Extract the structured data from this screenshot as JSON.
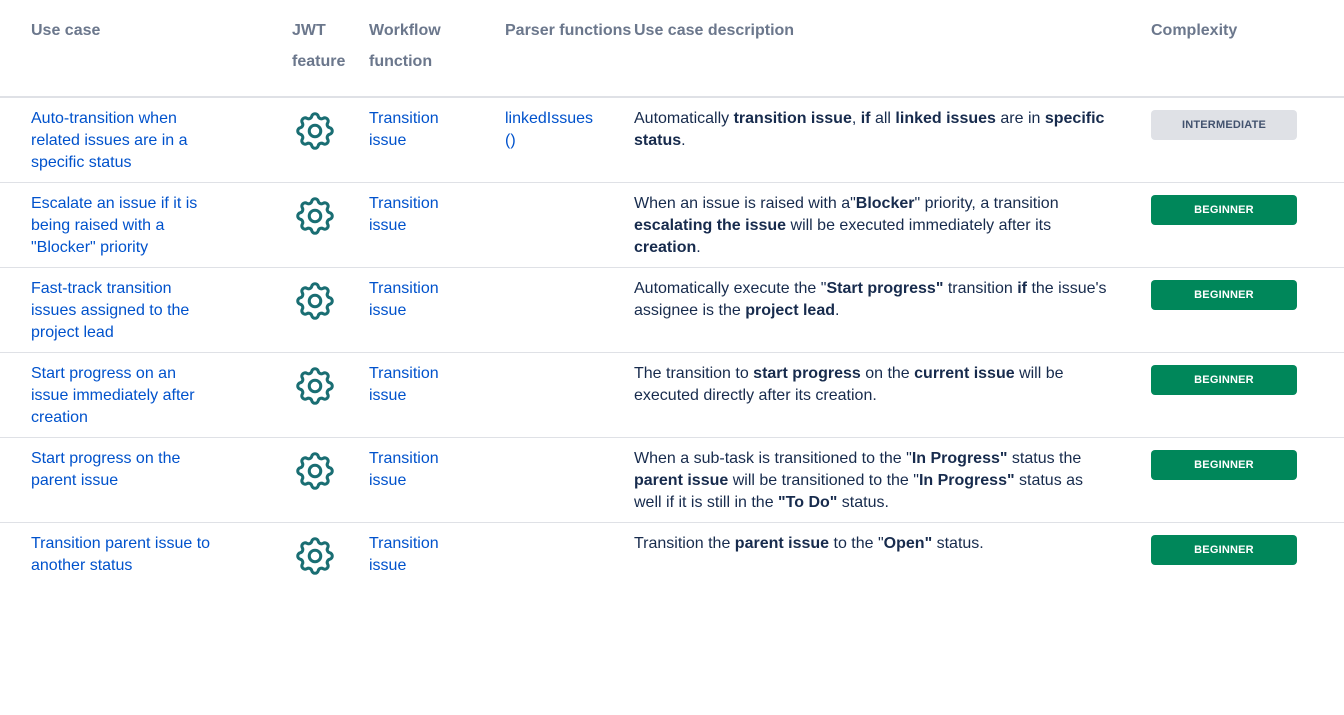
{
  "headers": {
    "use_case": "Use case",
    "jwt_feature": "JWT feature",
    "workflow_function": "Workflow function",
    "parser_functions": "Parser functions",
    "description": "Use case description",
    "complexity": "Complexity"
  },
  "icons": {
    "feature": "gear-icon",
    "color": "#1a6e73"
  },
  "colors": {
    "link": "#0052cc",
    "beginner": "#00875a",
    "intermediate": "#dfe1e6"
  },
  "rows": [
    {
      "use_case": "Auto-transition when related issues are in a specific status",
      "workflow_function": "Transition issue",
      "parser_functions": "linkedIssues()",
      "description": [
        {
          "t": "Automatically "
        },
        {
          "t": "transition issue",
          "b": true
        },
        {
          "t": ", "
        },
        {
          "t": "if",
          "b": true
        },
        {
          "t": " all "
        },
        {
          "t": "linked issues",
          "b": true
        },
        {
          "t": " are in "
        },
        {
          "t": "specific status",
          "b": true
        },
        {
          "t": "."
        }
      ],
      "complexity": "INTERMEDIATE",
      "complexity_level": "intermediate"
    },
    {
      "use_case": "Escalate an issue if it is being raised with a \"Blocker\" priority",
      "workflow_function": "Transition issue",
      "parser_functions": "",
      "description": [
        {
          "t": "When an issue is raised with a\""
        },
        {
          "t": "Blocker",
          "b": true
        },
        {
          "t": "\" priority, a transition "
        },
        {
          "t": "escalating the issue",
          "b": true
        },
        {
          "t": " will be executed immediately after its "
        },
        {
          "t": "creation",
          "b": true
        },
        {
          "t": "."
        }
      ],
      "complexity": "BEGINNER",
      "complexity_level": "beginner"
    },
    {
      "use_case": "Fast-track transition issues assigned to the project lead",
      "workflow_function": "Transition issue",
      "parser_functions": "",
      "description": [
        {
          "t": "Automatically execute the \""
        },
        {
          "t": "Start progress\"",
          "b": true
        },
        {
          "t": " transition "
        },
        {
          "t": "if",
          "b": true
        },
        {
          "t": " the issue's assignee is the "
        },
        {
          "t": "project lead",
          "b": true
        },
        {
          "t": "."
        }
      ],
      "complexity": "BEGINNER",
      "complexity_level": "beginner"
    },
    {
      "use_case": "Start progress on an issue immediately after creation",
      "workflow_function": "Transition issue",
      "parser_functions": "",
      "description": [
        {
          "t": "The transition to "
        },
        {
          "t": "start progress",
          "b": true
        },
        {
          "t": " on the "
        },
        {
          "t": "current issue",
          "b": true
        },
        {
          "t": " will be executed directly after its creation."
        }
      ],
      "complexity": "BEGINNER",
      "complexity_level": "beginner"
    },
    {
      "use_case": "Start progress on the parent issue",
      "workflow_function": "Transition issue",
      "parser_functions": "",
      "description": [
        {
          "t": "When a sub-task is transitioned to the \""
        },
        {
          "t": "In Progress\"",
          "b": true
        },
        {
          "t": " status the "
        },
        {
          "t": "parent issue",
          "b": true
        },
        {
          "t": " will be transitioned to the \""
        },
        {
          "t": "In Progress\"",
          "b": true
        },
        {
          "t": " status as well if it is still in the "
        },
        {
          "t": "\"To Do\"",
          "b": true
        },
        {
          "t": " status."
        }
      ],
      "complexity": "BEGINNER",
      "complexity_level": "beginner"
    },
    {
      "use_case": "Transition parent issue to another status",
      "workflow_function": "Transition issue",
      "parser_functions": "",
      "description": [
        {
          "t": "Transition the "
        },
        {
          "t": "parent issue",
          "b": true
        },
        {
          "t": " to the \""
        },
        {
          "t": "Open\"",
          "b": true
        },
        {
          "t": " status."
        }
      ],
      "complexity": "BEGINNER",
      "complexity_level": "beginner"
    }
  ]
}
